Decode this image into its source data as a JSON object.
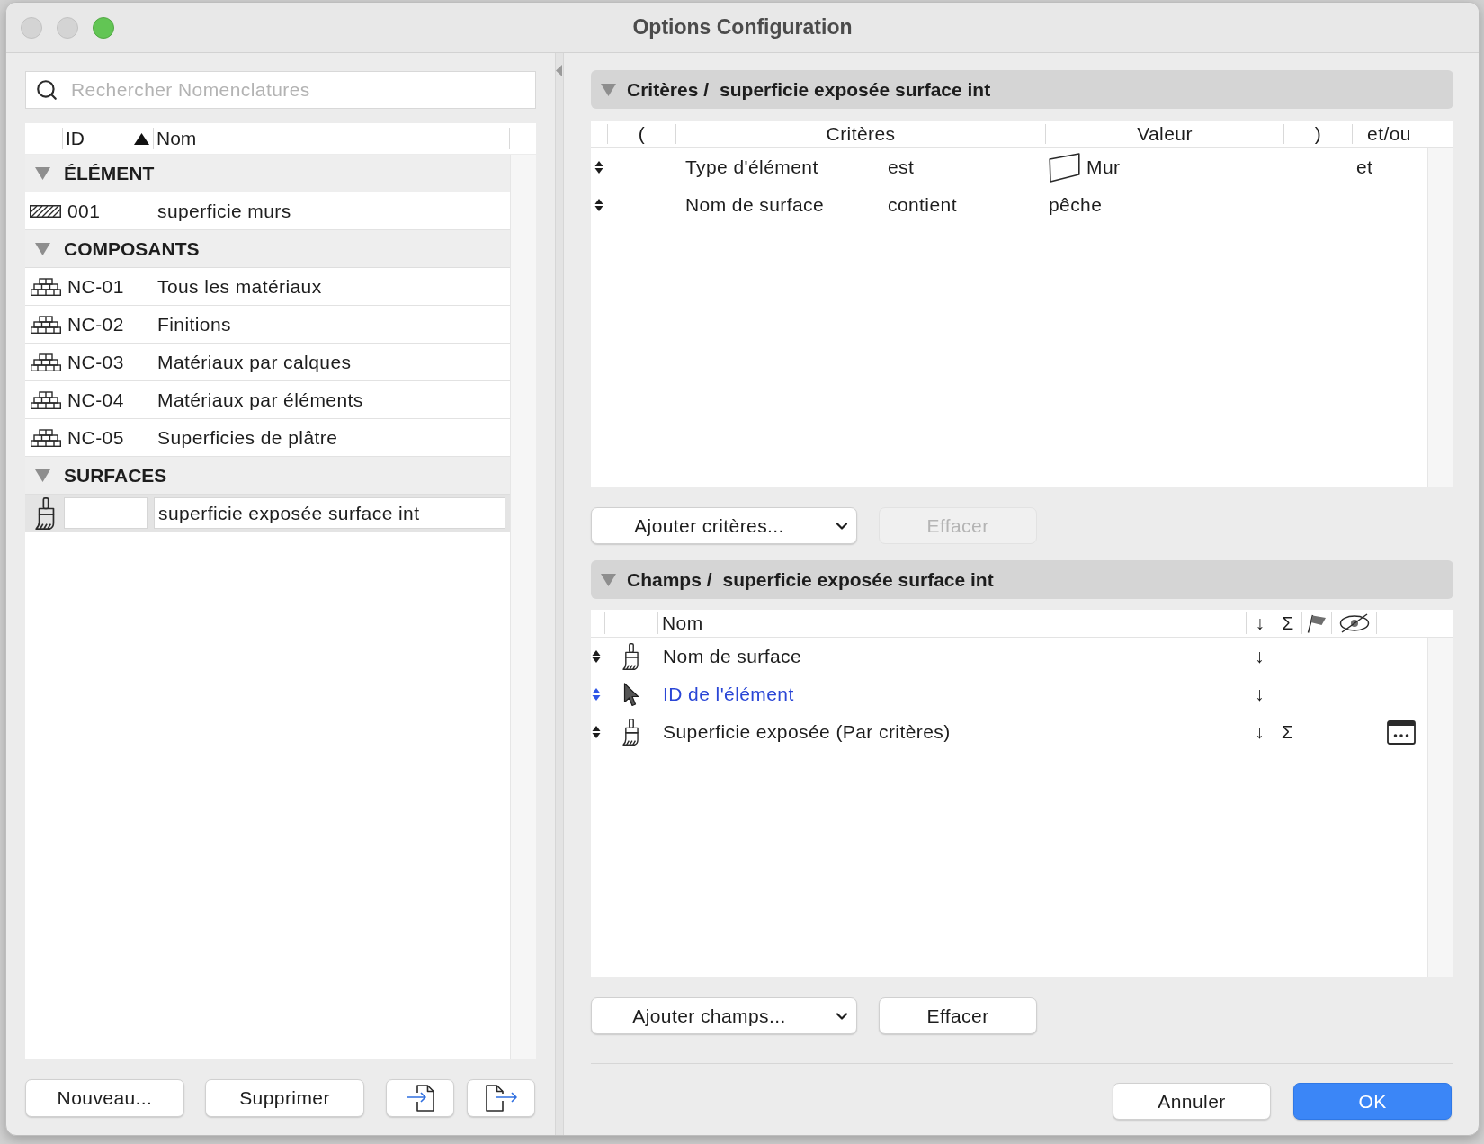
{
  "window": {
    "title": "Options Configuration",
    "controls": [
      {
        "kind": "close",
        "enabled": false
      },
      {
        "kind": "minimize",
        "enabled": false
      },
      {
        "kind": "zoom",
        "enabled": true
      }
    ]
  },
  "sidebar": {
    "search": {
      "placeholder": "Rechercher Nomenclatures"
    },
    "columns": [
      {
        "label": "ID",
        "sorted": true
      },
      {
        "label": "Nom",
        "sorted": false
      }
    ],
    "groups": [
      {
        "label": "ÉLÉMENT",
        "expanded": true,
        "children": [
          {
            "kind": "element",
            "id": "001",
            "name": "superficie murs",
            "selected": false,
            "editing": false
          }
        ]
      },
      {
        "label": "COMPOSANTS",
        "expanded": true,
        "children": [
          {
            "kind": "component",
            "id": "NC-01",
            "name": "Tous les matériaux",
            "selected": false,
            "editing": false
          },
          {
            "kind": "component",
            "id": "NC-02",
            "name": "Finitions",
            "selected": false,
            "editing": false
          },
          {
            "kind": "component",
            "id": "NC-03",
            "name": "Matériaux par calques",
            "selected": false,
            "editing": false
          },
          {
            "kind": "component",
            "id": "NC-04",
            "name": "Matériaux par éléments",
            "selected": false,
            "editing": false
          },
          {
            "kind": "component",
            "id": "NC-05",
            "name": "Superficies de plâtre",
            "selected": false,
            "editing": false
          }
        ]
      },
      {
        "label": "SURFACES",
        "expanded": true,
        "children": [
          {
            "kind": "surface",
            "name": "superficie exposée surface int",
            "selected": true,
            "editing": true
          }
        ]
      }
    ],
    "buttons": [
      {
        "kind": "new",
        "label": "Nouveau..."
      },
      {
        "kind": "delete",
        "label": "Supprimer"
      },
      {
        "kind": "import"
      },
      {
        "kind": "export"
      }
    ]
  },
  "criteria": {
    "title": "Critères /",
    "subject": "superficie exposée surface int",
    "expanded": true,
    "columns": [
      "(",
      "Critères",
      "Valeur",
      ")",
      "et/ou"
    ],
    "rows": [
      {
        "kind": "element_type",
        "field": "Type d'élément",
        "operator": "est",
        "value": "Mur",
        "and_or": "et"
      },
      {
        "kind": "property",
        "field": "Nom de surface",
        "operator": "contient",
        "value": "pêche"
      }
    ],
    "add_button": "Ajouter critères...",
    "clear_button": {
      "label": "Effacer",
      "disabled": true
    }
  },
  "fields": {
    "title": "Champs /",
    "subject": "superficie exposée surface int",
    "expanded": true,
    "columns": {
      "name": "Nom",
      "sort": "↓",
      "sum": "Σ"
    },
    "rows": [
      {
        "kind": "surface",
        "name": "Nom de surface",
        "highlighted": false,
        "sort": "↓",
        "has_options": false
      },
      {
        "kind": "element",
        "name": "ID de l'élément",
        "highlighted": true,
        "sort": "↓",
        "has_options": false
      },
      {
        "kind": "surface",
        "name": "Superficie exposée (Par critères)",
        "highlighted": false,
        "sort": "↓",
        "sum": "Σ",
        "has_options": true
      }
    ],
    "add_button": "Ajouter champs...",
    "clear_button": {
      "label": "Effacer",
      "disabled": false
    }
  },
  "footer": {
    "buttons": [
      {
        "label": "Annuler",
        "default": false
      },
      {
        "label": "OK",
        "default": true
      }
    ]
  }
}
